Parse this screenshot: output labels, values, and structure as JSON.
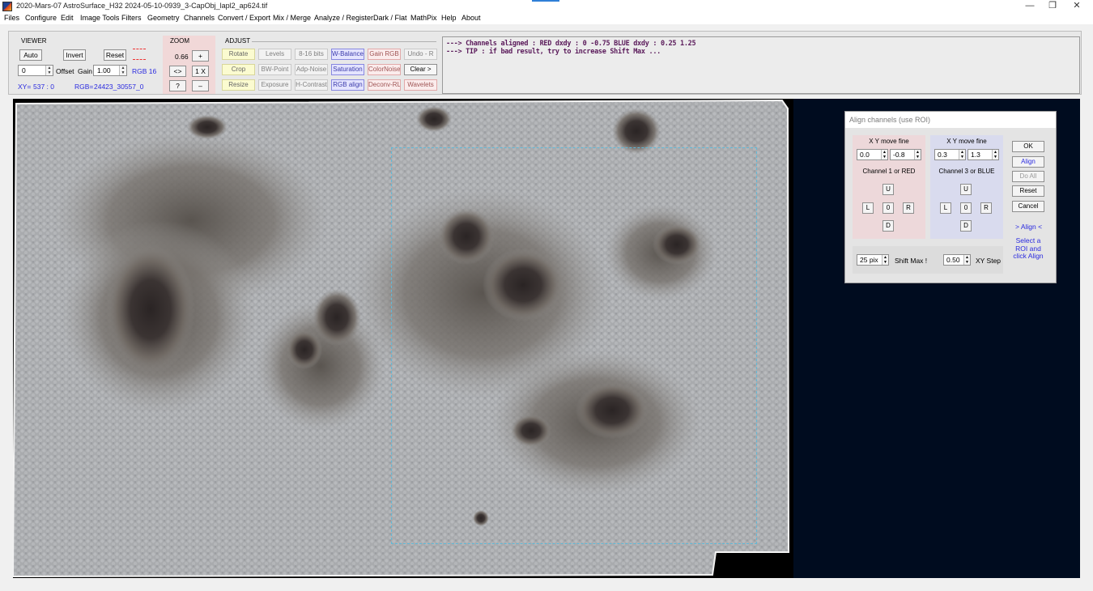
{
  "window": {
    "title": "2020-Mars-07  AstroSurface_H32    2024-05-10-0939_3-CapObj_lapl2_ap624.tif",
    "minimize": "—",
    "restore": "❐",
    "close": "✕"
  },
  "menu": [
    "Files",
    "Configure",
    "Edit",
    "Image Tools",
    "Filters",
    "Geometry",
    "Channels",
    "Convert / Export",
    "Mix / Merge",
    "Analyze / Register",
    "Dark / Flat",
    "MathPix",
    "Help",
    "About"
  ],
  "viewer": {
    "title": "VIEWER",
    "auto": "Auto",
    "invert": "Invert",
    "reset": "Reset",
    "offset_value": "0",
    "offset_label": "Offset",
    "gain_label": "Gain",
    "gain_value": "1.00",
    "rgb_depth": "RGB 16",
    "xy_label": "XY=",
    "xy_value": "537 : 0",
    "rgb_label": "RGB=",
    "rgb_value": "24423_30557_0"
  },
  "zoom": {
    "title": "ZOOM",
    "value": "0.66",
    "plus": "+",
    "fit": "<>",
    "one_x": "1 X",
    "help": "?",
    "minus": "–"
  },
  "adjust": {
    "title": "ADJUST",
    "rows": [
      [
        "Rotate",
        "Levels",
        "8-16 bits",
        "W-Balance",
        "Gain RGB",
        "Undo - R"
      ],
      [
        "Crop",
        "BW-Point",
        "Adp-Noise",
        "Saturation",
        "ColorNoise",
        "Clear >"
      ],
      [
        "Resize",
        "Exposure",
        "H-Contrast",
        "RGB align",
        "Deconv-RL",
        "Wavelets"
      ]
    ]
  },
  "messages": {
    "line1": "--->  Channels aligned :  RED  dxdy :  0   -0.75      BLUE  dxdy :  0.25   1.25",
    "line2": "--->  TIP :  if bad result, try to increase Shift Max ..."
  },
  "dialog": {
    "title": "Align channels (use ROI)",
    "red": {
      "header": "X  Y  move fine",
      "x": "0.0",
      "y": "-0.8",
      "label": "Channel 1 or RED"
    },
    "blue": {
      "header": "X  Y  move fine",
      "x": "0.3",
      "y": "1.3",
      "label": "Channel 3 or BLUE"
    },
    "up": "U",
    "left": "L",
    "zero": "0",
    "right": "R",
    "down": "D",
    "shift_value": "25 pix",
    "shift_label": "Shift Max !",
    "step_value": "0.50",
    "step_label": "XY Step",
    "ok": "OK",
    "align": "Align",
    "do_all": "Do All",
    "reset": "Reset",
    "cancel": "Cancel",
    "align_hint": "> Align <",
    "roi_hint": "Select a ROI and click Align"
  },
  "colors": {
    "blue_text": "#2a2adf",
    "message_text": "#5a1a5a",
    "image_background": "#000c1f",
    "roi_outline": "#5fb9d8"
  }
}
